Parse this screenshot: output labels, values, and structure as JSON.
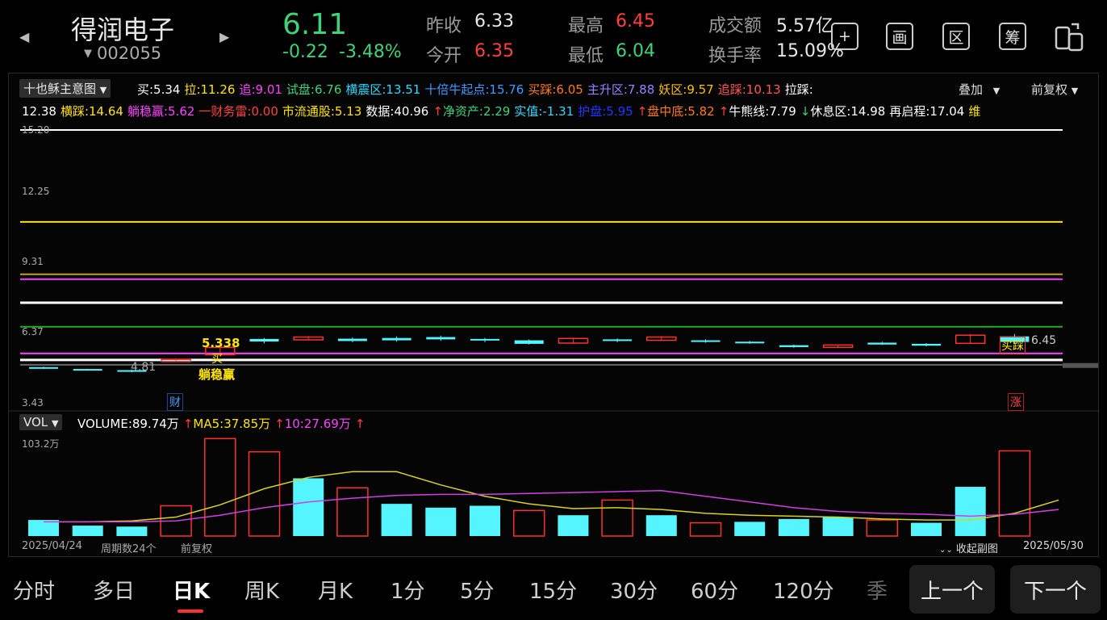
{
  "header": {
    "stock_name": "得润电子",
    "stock_code": "002055",
    "price": "6.11",
    "change": "-0.22",
    "change_pct": "-3.48%",
    "prev_close_label": "昨收",
    "prev_close": "6.33",
    "open_label": "今开",
    "open": "6.35",
    "high_label": "最高",
    "high": "6.45",
    "low_label": "最低",
    "low": "6.04",
    "amount_label": "成交额",
    "amount": "5.57亿",
    "turnover_label": "换手率",
    "turnover": "15.09%",
    "tools": [
      "+",
      "画",
      "区",
      "筹"
    ],
    "tool_icons": [
      "add-icon",
      "draw-icon",
      "range-icon",
      "chips-icon",
      "device-switch-icon"
    ]
  },
  "main_chart": {
    "indicator_name": "十也稣主意图",
    "overlay_label": "叠加",
    "adjust_label": "前复权",
    "legend_line1": [
      {
        "text": "买:5.34",
        "color": "#ffffff"
      },
      {
        "text": "拉:11.26",
        "color": "#ffe400"
      },
      {
        "text": "追:9.01",
        "color": "#ff44ff"
      },
      {
        "text": "试盘:6.76",
        "color": "#3fd27a"
      },
      {
        "text": "横震区:13.51",
        "color": "#33d6ff"
      },
      {
        "text": "十倍牛起点:15.76",
        "color": "#3d9bff"
      },
      {
        "text": "买踩:6.05",
        "color": "#ff7a1a"
      },
      {
        "text": "主升区:7.88",
        "color": "#8f86ff"
      },
      {
        "text": "妖区:9.57",
        "color": "#ffc000"
      },
      {
        "text": "追踩:10.13",
        "color": "#ff5555"
      },
      {
        "text": "拉踩:",
        "color": "#ffffff"
      }
    ],
    "legend_line2": [
      {
        "text": "12.38",
        "color": "#ffffff"
      },
      {
        "text": "横踩:14.64",
        "color": "#ffe400"
      },
      {
        "text": "躺稳赢:5.62",
        "color": "#ff44ff"
      },
      {
        "text": "一财务雷:0.00",
        "color": "#ff4040"
      },
      {
        "text": "市流通股:5.13",
        "color": "#ffe400"
      },
      {
        "text": "数据:40.96",
        "color": "#ffffff"
      },
      {
        "text": "↑",
        "color": "#ff4040"
      },
      {
        "text": "净资产:2.29",
        "color": "#3fd27a"
      },
      {
        "text": "实值:-1.31",
        "color": "#33d6ff"
      },
      {
        "text": "护盘:5.95",
        "color": "#2236ff"
      },
      {
        "text": "↑",
        "color": "#ff4040"
      },
      {
        "text": "盘中底:5.82",
        "color": "#ff7a1a"
      },
      {
        "text": "↑",
        "color": "#ff4040"
      },
      {
        "text": "牛熊线:7.79",
        "color": "#ffffff"
      },
      {
        "text": "↓",
        "color": "#3fd27a"
      },
      {
        "text": "休息区:14.98",
        "color": "#ffffff"
      },
      {
        "text": "再启程:17.04",
        "color": "#ffffff"
      },
      {
        "text": "维",
        "color": "#ffe400"
      }
    ],
    "y_ticks": [
      "15.20",
      "12.25",
      "9.31",
      "6.37",
      "3.43"
    ],
    "annotations": {
      "buy_value": "5.338",
      "buy_label": "买",
      "hold_label": "躺稳赢",
      "low_value": "4.81",
      "high_value": "6.45",
      "buy_step_label": "买踩",
      "finance_label": "财",
      "limit_up_label": "涨"
    }
  },
  "volume_chart": {
    "indicator_name": "VOL",
    "legend": [
      {
        "text": "VOLUME:89.74万",
        "color": "#ffffff"
      },
      {
        "text": "↑",
        "color": "#ff4040"
      },
      {
        "text": "MA5:37.85万",
        "color": "#ffe400"
      },
      {
        "text": "↑",
        "color": "#ff4040"
      },
      {
        "text": "10:27.69万",
        "color": "#ff44ff"
      },
      {
        "text": "↑",
        "color": "#ff4040"
      }
    ],
    "y_max_label": "103.2万"
  },
  "chart_footer": {
    "start_date": "2025/04/24",
    "period_count": "周期数24个",
    "adjust_label": "前复权",
    "collapse_label": "收起副图",
    "end_date": "2025/05/30"
  },
  "bottom_tabs": [
    "分时",
    "多日",
    "日K",
    "周K",
    "月K",
    "1分",
    "5分",
    "15分",
    "30分",
    "60分",
    "120分",
    "季"
  ],
  "active_tab": "日K",
  "nav": {
    "prev": "上一个",
    "next": "下一个"
  },
  "colors": {
    "up": "#ff3030",
    "down": "#55f5ff",
    "ma5": "#d9d21f",
    "ma10": "#d040e0"
  },
  "chart_data": [
    {
      "type": "candlestick",
      "y_axis_ticks": [
        15.2,
        12.25,
        9.31,
        6.37,
        3.43
      ],
      "candles": [
        {
          "o": 5.03,
          "c": 4.98,
          "h": 5.05,
          "l": 4.95,
          "up": false
        },
        {
          "o": 4.95,
          "c": 4.93,
          "h": 4.96,
          "l": 4.91,
          "up": false
        },
        {
          "o": 4.9,
          "c": 4.88,
          "h": 4.92,
          "l": 4.81,
          "up": false
        },
        {
          "o": 5.27,
          "c": 5.36,
          "h": 5.38,
          "l": 5.25,
          "up": true
        },
        {
          "o": 5.56,
          "c": 5.88,
          "h": 5.9,
          "l": 5.5,
          "up": true
        },
        {
          "o": 6.24,
          "c": 6.13,
          "h": 6.28,
          "l": 6.05,
          "up": false
        },
        {
          "o": 6.2,
          "c": 6.32,
          "h": 6.36,
          "l": 6.18,
          "up": true
        },
        {
          "o": 6.25,
          "c": 6.15,
          "h": 6.3,
          "l": 6.1,
          "up": false
        },
        {
          "o": 6.28,
          "c": 6.18,
          "h": 6.35,
          "l": 6.12,
          "up": false
        },
        {
          "o": 6.32,
          "c": 6.22,
          "h": 6.38,
          "l": 6.16,
          "up": false
        },
        {
          "o": 6.24,
          "c": 6.2,
          "h": 6.28,
          "l": 6.1,
          "up": false
        },
        {
          "o": 6.18,
          "c": 6.03,
          "h": 6.22,
          "l": 6.0,
          "up": false
        },
        {
          "o": 6.06,
          "c": 6.26,
          "h": 6.3,
          "l": 6.02,
          "up": true
        },
        {
          "o": 6.22,
          "c": 6.18,
          "h": 6.26,
          "l": 6.1,
          "up": false
        },
        {
          "o": 6.18,
          "c": 6.32,
          "h": 6.36,
          "l": 6.15,
          "up": true
        },
        {
          "o": 6.18,
          "c": 6.14,
          "h": 6.22,
          "l": 6.08,
          "up": false
        },
        {
          "o": 6.12,
          "c": 6.07,
          "h": 6.16,
          "l": 6.03,
          "up": false
        },
        {
          "o": 5.97,
          "c": 5.89,
          "h": 6.0,
          "l": 5.86,
          "up": false
        },
        {
          "o": 5.88,
          "c": 5.98,
          "h": 6.0,
          "l": 5.86,
          "up": true
        },
        {
          "o": 6.08,
          "c": 6.0,
          "h": 6.12,
          "l": 5.98,
          "up": false
        },
        {
          "o": 6.03,
          "c": 5.95,
          "h": 6.06,
          "l": 5.92,
          "up": false
        },
        {
          "o": 6.05,
          "c": 6.4,
          "h": 6.45,
          "l": 6.04,
          "up": true
        },
        {
          "o": 6.35,
          "c": 6.11,
          "h": 6.45,
          "l": 6.04,
          "up": false
        }
      ],
      "horizontal_lines": [
        {
          "value": 15.2,
          "color": "#ffffff"
        },
        {
          "value": 11.26,
          "color": "#ffe400"
        },
        {
          "value": 9.01,
          "color": "#c8a000"
        },
        {
          "value": 8.8,
          "color": "#ff33ff"
        },
        {
          "value": 7.79,
          "color": "#ffffff"
        },
        {
          "value": 6.76,
          "color": "#22aa22"
        },
        {
          "value": 5.62,
          "color": "#ff44ff"
        },
        {
          "value": 5.34,
          "color": "#ffffff"
        },
        {
          "value": 5.13,
          "color": "#666666"
        }
      ]
    },
    {
      "type": "bar",
      "unit": "万",
      "ylim": [
        0,
        103.2
      ],
      "volume": [
        17,
        11,
        10,
        32,
        103,
        89,
        61,
        51,
        34,
        30,
        32,
        27,
        22,
        38,
        22,
        14,
        15,
        18,
        20,
        17,
        14,
        52,
        90
      ],
      "volume_up": [
        false,
        false,
        false,
        true,
        true,
        true,
        false,
        true,
        false,
        false,
        false,
        true,
        false,
        true,
        false,
        true,
        false,
        false,
        false,
        true,
        false,
        false,
        true,
        false
      ],
      "ma5": [
        15,
        15,
        16,
        20,
        33,
        50,
        62,
        68,
        68,
        54,
        42,
        34,
        29,
        30,
        28,
        24,
        22,
        21,
        20,
        18,
        17,
        17,
        24,
        38
      ],
      "ma10": [
        15,
        15,
        15,
        16,
        22,
        30,
        36,
        40,
        43,
        44,
        44,
        45,
        46,
        47,
        48,
        42,
        36,
        30,
        26,
        24,
        23,
        21,
        23,
        28
      ]
    }
  ]
}
